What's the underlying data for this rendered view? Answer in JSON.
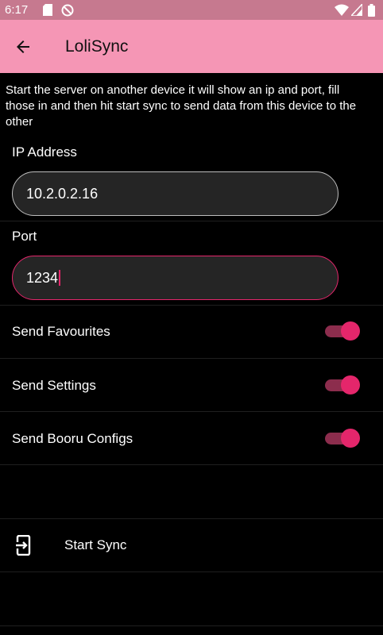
{
  "status_bar": {
    "time": "6:17",
    "icons": [
      "sd-card-icon",
      "do-not-disturb-icon",
      "wifi-icon",
      "signal-icon",
      "battery-icon"
    ]
  },
  "app_bar": {
    "title": "LoliSync",
    "back_icon": "arrow-left-icon",
    "color": "#f596b5"
  },
  "description": "Start the server on another device it will show an ip and port, fill those in and then hit start sync to send data from this device to the other",
  "fields": {
    "ip": {
      "label": "IP Address",
      "value": "10.2.0.2.16"
    },
    "port": {
      "label": "Port",
      "value": "1234"
    }
  },
  "toggles": [
    {
      "label": "Send Favourites",
      "on": true
    },
    {
      "label": "Send Settings",
      "on": true
    },
    {
      "label": "Send Booru Configs",
      "on": true
    }
  ],
  "sync": {
    "label": "Start Sync",
    "icon": "exit-to-app-icon"
  },
  "colors": {
    "accent": "#e4266b",
    "background": "#000000"
  }
}
